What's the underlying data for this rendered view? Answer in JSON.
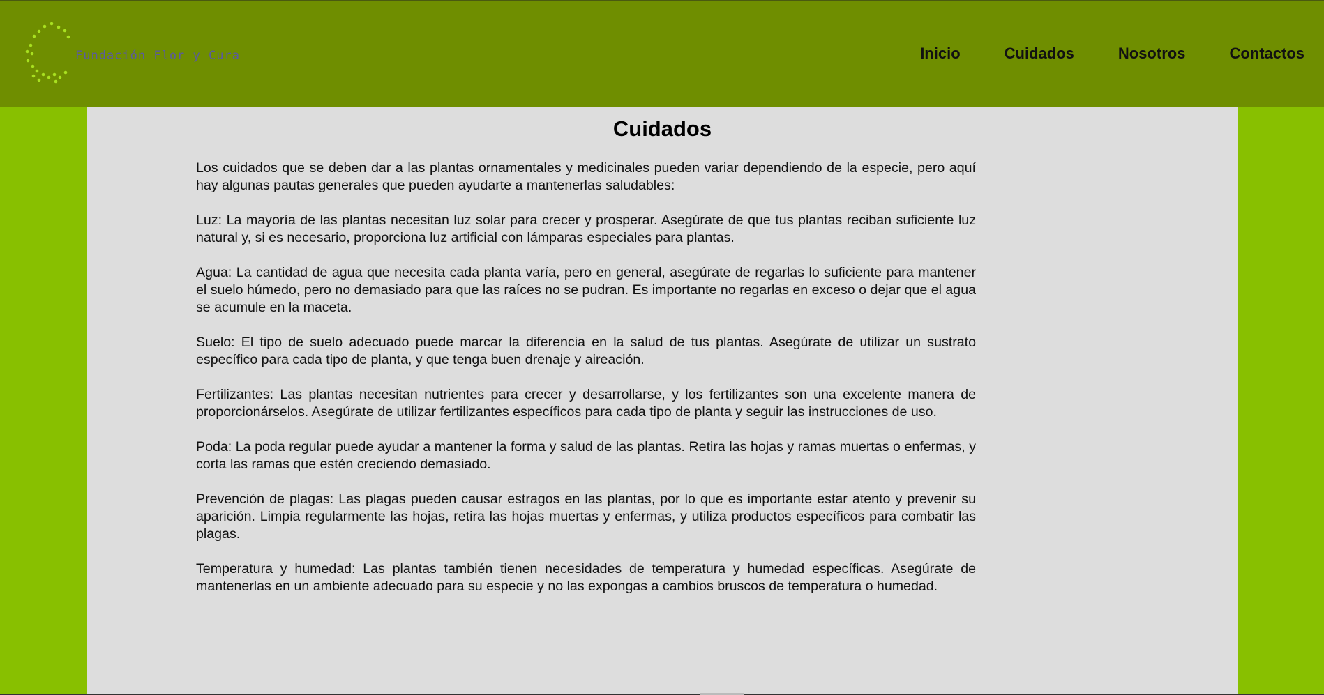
{
  "header": {
    "logo_text": "Fundación Flor y Cura",
    "nav": [
      {
        "label": "Inicio"
      },
      {
        "label": "Cuidados"
      },
      {
        "label": "Nosotros"
      },
      {
        "label": "Contactos"
      }
    ]
  },
  "main": {
    "title": "Cuidados",
    "paragraphs": [
      "Los cuidados que se deben dar a las plantas ornamentales y medicinales pueden variar dependiendo de la especie, pero aquí hay algunas pautas generales que pueden ayudarte a mantenerlas saludables:",
      "Luz: La mayoría de las plantas necesitan luz solar para crecer y prosperar. Asegúrate de que tus plantas reciban suficiente luz natural y, si es necesario, proporciona luz artificial con lámparas especiales para plantas.",
      "Agua: La cantidad de agua que necesita cada planta varía, pero en general, asegúrate de regarlas lo suficiente para mantener el suelo húmedo, pero no demasiado para que las raíces no se pudran. Es importante no regarlas en exceso o dejar que el agua se acumule en la maceta.",
      "Suelo: El tipo de suelo adecuado puede marcar la diferencia en la salud de tus plantas. Asegúrate de utilizar un sustrato específico para cada tipo de planta, y que tenga buen drenaje y aireación.",
      "Fertilizantes: Las plantas necesitan nutrientes para crecer y desarrollarse, y los fertilizantes son una excelente manera de proporcionárselos. Asegúrate de utilizar fertilizantes específicos para cada tipo de planta y seguir las instrucciones de uso.",
      "Poda: La poda regular puede ayudar a mantener la forma y salud de las plantas. Retira las hojas y ramas muertas o enfermas, y corta las ramas que estén creciendo demasiado.",
      "Prevención de plagas: Las plagas pueden causar estragos en las plantas, por lo que es importante estar atento y prevenir su aparición. Limpia regularmente las hojas, retira las hojas muertas y enfermas, y utiliza productos específicos para combatir las plagas.",
      "Temperatura y humedad: Las plantas también tienen necesidades de temperatura y humedad específicas. Asegúrate de mantenerlas en un ambiente adecuado para su especie y no las expongas a cambios bruscos de temperatura o humedad."
    ]
  },
  "colors": {
    "header_bg": "#6f8e00",
    "side_bg": "#88c000",
    "content_bg": "#dddddd",
    "logo_dots": "#a8e020"
  },
  "icons": {
    "logo": "dotted-circle-logo-icon"
  }
}
